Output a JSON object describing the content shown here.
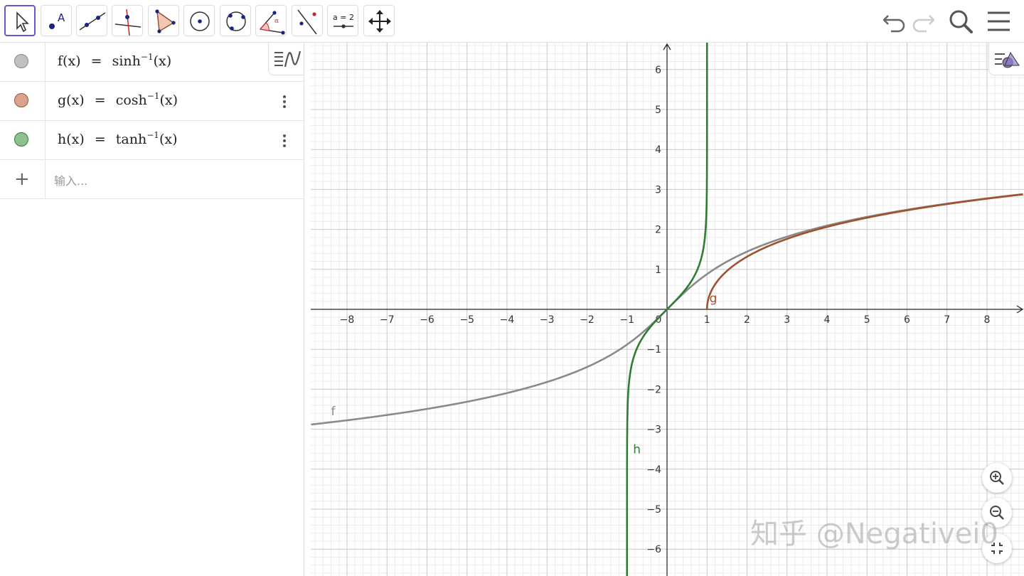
{
  "toolbar": {
    "tools": [
      "move",
      "point",
      "line",
      "perpendicular-line",
      "polygon",
      "circle-center-point",
      "circle-three-points",
      "angle",
      "reflect",
      "slider",
      "move-graphics-view"
    ],
    "slider_label": "a = 2",
    "point_label": "A"
  },
  "algebra": {
    "rows": [
      {
        "name": "f",
        "lhs": "f(x)",
        "eq": "=",
        "func": "sinh",
        "sup": "−1",
        "arg": "(x)",
        "color": "#c0c0c0",
        "border": "#888888"
      },
      {
        "name": "g",
        "lhs": "g(x)",
        "eq": "=",
        "func": "cosh",
        "sup": "−1",
        "arg": "(x)",
        "color": "#d8a38f",
        "border": "#a0522d"
      },
      {
        "name": "h",
        "lhs": "h(x)",
        "eq": "=",
        "func": "tanh",
        "sup": "−1",
        "arg": "(x)",
        "color": "#8fc08f",
        "border": "#2e7d32"
      }
    ],
    "input_placeholder": "输入..."
  },
  "graph": {
    "x_ticks": [
      "−8",
      "−7",
      "−6",
      "−5",
      "−4",
      "−3",
      "−2",
      "−1",
      "0",
      "1",
      "2",
      "3",
      "4",
      "5",
      "6",
      "7",
      "8"
    ],
    "y_ticks": [
      "6",
      "5",
      "4",
      "3",
      "2",
      "1",
      "−1",
      "−2",
      "−3",
      "−4",
      "−5",
      "−6"
    ],
    "curve_labels": {
      "f": "f",
      "g": "g",
      "h": "h"
    },
    "colors": {
      "f": "#8a8a8a",
      "g": "#a0522d",
      "h": "#2e7d32",
      "grid_major": "#c8c8c8",
      "grid_minor": "#ececec",
      "axis": "#222222"
    }
  },
  "chart_data": {
    "type": "line",
    "xlim": [
      -8.9,
      8.9
    ],
    "ylim": [
      -6.6,
      6.7
    ],
    "grid": true,
    "series": [
      {
        "name": "f",
        "function": "asinh(x)"
      },
      {
        "name": "g",
        "function": "acosh(x)"
      },
      {
        "name": "h",
        "function": "atanh(x)"
      }
    ]
  },
  "watermark": "知乎 @Negativei0"
}
